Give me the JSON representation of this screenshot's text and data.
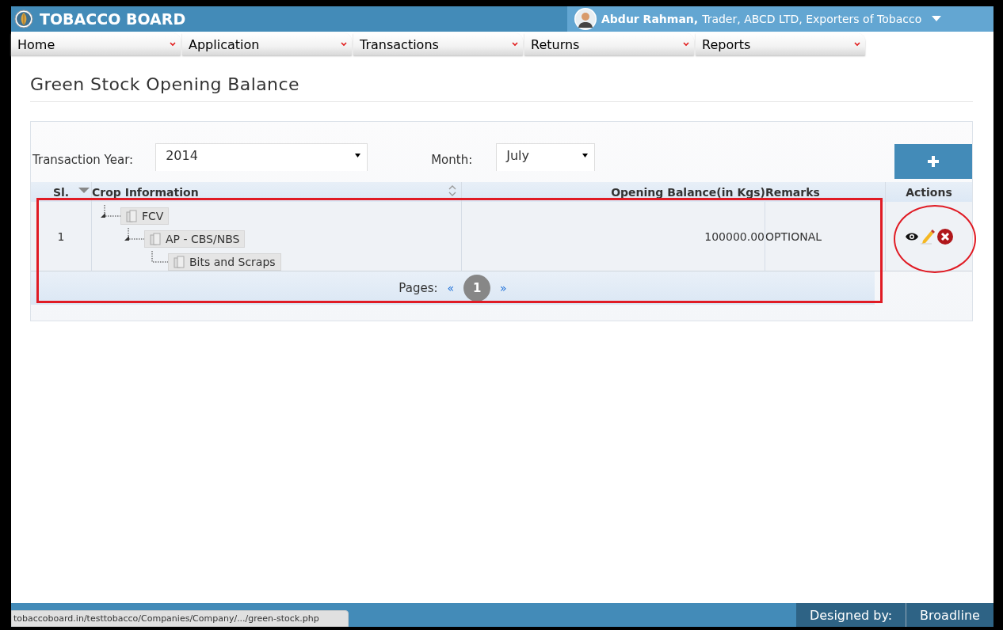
{
  "header": {
    "brand": "TOBACCO BOARD",
    "user_name": "Abdur Rahman,",
    "user_role": "Trader, ABCD LTD, Exporters of Tobacco"
  },
  "menu": [
    {
      "label": "Home"
    },
    {
      "label": "Application"
    },
    {
      "label": "Transactions"
    },
    {
      "label": "Returns"
    },
    {
      "label": "Reports"
    }
  ],
  "page_title": "Green Stock Opening Balance",
  "filters": {
    "year_label": "Transaction Year:",
    "year": "2014",
    "month_label": "Month:",
    "month": "July"
  },
  "table": {
    "columns": [
      "Sl.",
      "Crop Information",
      "Opening Balance(in Kgs)",
      "Remarks",
      "Actions"
    ],
    "rows": [
      {
        "sl": "1",
        "crop": [
          {
            "label": "FCV",
            "expanded": true,
            "children": [
              {
                "label": "AP - CBS/NBS",
                "expanded": true,
                "children": [
                  {
                    "label": "Bits and Scraps"
                  }
                ]
              }
            ]
          }
        ],
        "opening_balance": "100000.00",
        "remarks": "OPTIONAL"
      }
    ]
  },
  "pager": {
    "label": "Pages:",
    "prev": "«",
    "next": "»",
    "pages": [
      {
        "label": "1",
        "selected": true
      }
    ]
  },
  "footer": {
    "designed_by_label": "Designed by:",
    "designed_by": "Broadline"
  },
  "status_url": "tobaccoboard.in/testtobacco/Companies/Company/.../green-stock.php"
}
